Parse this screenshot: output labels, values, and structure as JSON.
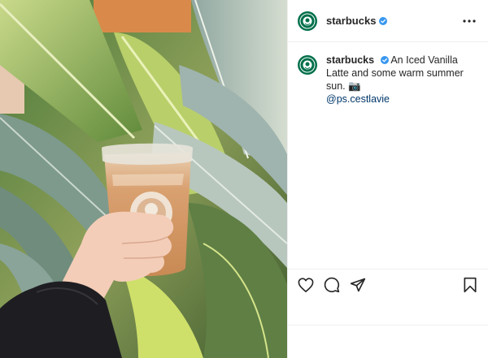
{
  "post": {
    "username": "starbucks",
    "verified": true,
    "caption_username": "starbucks",
    "caption_text": "An Iced Vanilla Latte and some warm summer sun. 📷",
    "caption_mention": "@ps.cestlavie",
    "icons": {
      "more": "more-options-icon",
      "like": "heart-icon",
      "comment": "comment-icon",
      "share": "share-icon",
      "save": "bookmark-icon",
      "verified": "verified-badge-icon"
    },
    "colors": {
      "brand": "#00704a",
      "verified": "#3897f0",
      "mention": "#00376b"
    }
  }
}
